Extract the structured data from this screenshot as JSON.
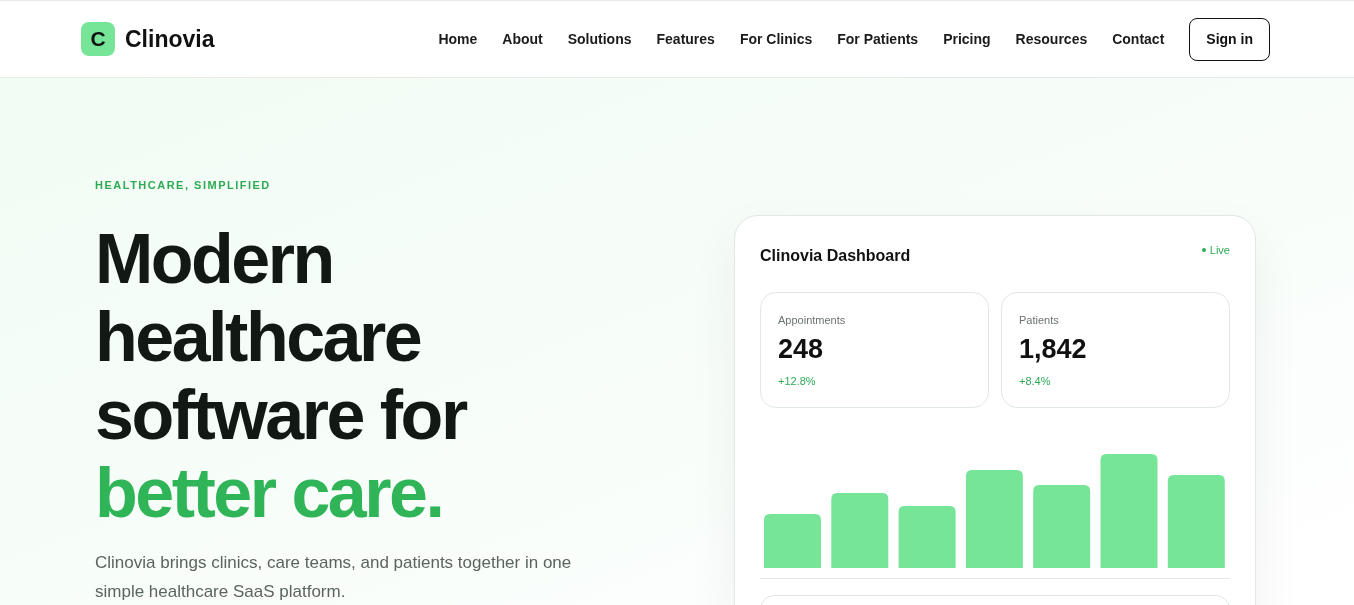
{
  "brand": {
    "mark": "C",
    "name": "Clinovia"
  },
  "nav": {
    "links": [
      "Home",
      "About",
      "Solutions",
      "Features",
      "For Clinics",
      "For Patients",
      "Pricing",
      "Resources",
      "Contact"
    ],
    "button": "Sign in"
  },
  "hero": {
    "eyebrow": "HEALTHCARE, SIMPLIFIED",
    "headline_lines": [
      "Modern",
      "healthcare",
      "software for"
    ],
    "headline_accent": "better care.",
    "description": "Clinovia brings clinics, care teams, and patients together in one simple healthcare SaaS platform."
  },
  "dashboard": {
    "title": "Clinovia Dashboard",
    "status": "Live",
    "stats": [
      {
        "label": "Appointments",
        "value": "248",
        "change": "+12.8%"
      },
      {
        "label": "Patients",
        "value": "1,842",
        "change": "+8.4%"
      }
    ]
  }
}
